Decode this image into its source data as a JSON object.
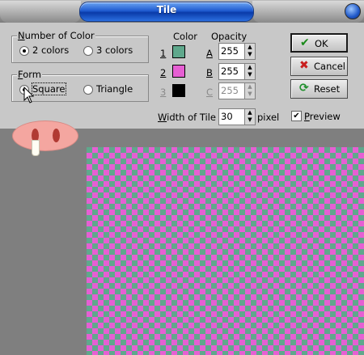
{
  "window": {
    "title": "Tile"
  },
  "number_of_color": {
    "legend": "Number of Color",
    "options": [
      {
        "label": "2 colors",
        "selected": true
      },
      {
        "label": "3 colors",
        "selected": false
      }
    ]
  },
  "form": {
    "legend": "Form",
    "options": [
      {
        "label": "Square",
        "selected": true
      },
      {
        "label": "Triangle",
        "selected": false
      }
    ]
  },
  "colors": {
    "color_header": "Color",
    "opacity_header": "Opacity",
    "rows": [
      {
        "index": "1",
        "swatch": "#5fa88c",
        "letter": "A",
        "opacity": "255",
        "enabled": true
      },
      {
        "index": "2",
        "swatch": "#e65fd3",
        "letter": "B",
        "opacity": "255",
        "enabled": true
      },
      {
        "index": "3",
        "swatch": "#000000",
        "letter": "C",
        "opacity": "255",
        "enabled": false
      }
    ]
  },
  "width_of_tile": {
    "label": "Width of Tile",
    "value": "30",
    "unit": "pixel"
  },
  "preview": {
    "label": "Preview",
    "checked": true
  },
  "buttons": {
    "ok": "OK",
    "cancel": "Cancel",
    "reset": "Reset"
  },
  "icons": {
    "ok": "checkmark-icon",
    "cancel": "x-icon",
    "reset": "refresh-icon",
    "pointer": "mouse-cursor-icon"
  },
  "canvas": {
    "pattern": "checkerboard",
    "color_a": "#5fa88c",
    "color_b": "#e65fd3"
  }
}
